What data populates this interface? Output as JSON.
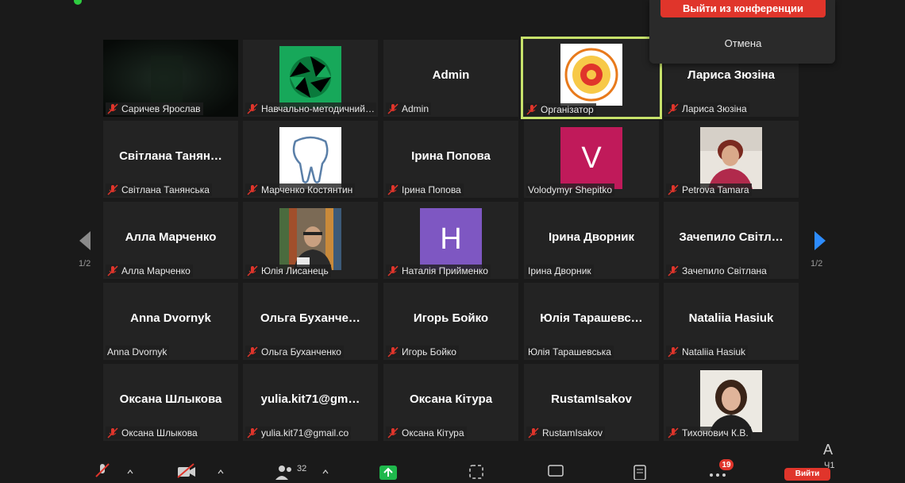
{
  "popup": {
    "leave_label": "Выйти из конференции",
    "cancel_label": "Отмена"
  },
  "pagination": {
    "left": "1/2",
    "right": "1/2"
  },
  "tiles": [
    {
      "name": "Саричев Ярослав",
      "center": "",
      "muted": true
    },
    {
      "name": "Навчально-методичний…",
      "center": "",
      "muted": true
    },
    {
      "name": "Admin",
      "center": "Admin",
      "muted": true
    },
    {
      "name": "Організатор",
      "center": "",
      "muted": true
    },
    {
      "name": "Лариса Зюзіна",
      "center": "Лариса Зюзіна",
      "muted": true
    },
    {
      "name": "Світлана Танянська",
      "center": "Світлана Танян…",
      "muted": true
    },
    {
      "name": "Марченко Костянтин",
      "center": "",
      "muted": true
    },
    {
      "name": "Ірина Попова",
      "center": "Ірина Попова",
      "muted": true
    },
    {
      "name": "Volodymyr Shepitko",
      "center": "",
      "muted": false,
      "letter": "V"
    },
    {
      "name": "Petrova Tamara",
      "center": "",
      "muted": true
    },
    {
      "name": "Алла Марченко",
      "center": "Алла Марченко",
      "muted": true
    },
    {
      "name": "Юлія Лисанець",
      "center": "",
      "muted": true
    },
    {
      "name": "Наталія Приймeнко",
      "center": "",
      "muted": true,
      "letter": "H"
    },
    {
      "name": "Ірина Дворник",
      "center": "Ірина Дворник",
      "muted": false
    },
    {
      "name": "Зачепило Світлана",
      "center": "Зачепило  Світл…",
      "muted": true
    },
    {
      "name": "Anna Dvornyk",
      "center": "Anna Dvornyk",
      "muted": false
    },
    {
      "name": "Ольга Буханченко",
      "center": "Ольга  Буханче…",
      "muted": true
    },
    {
      "name": "Игорь Бойко",
      "center": "Игорь Бойко",
      "muted": true
    },
    {
      "name": "Юлія Тарашевська",
      "center": "Юлія  Тарашевс…",
      "muted": false
    },
    {
      "name": "Nataliia Hasiuk",
      "center": "Nataliia Hasiuk",
      "muted": true
    },
    {
      "name": "Оксана Шлыкова",
      "center": "Оксана Шлыкова",
      "muted": true
    },
    {
      "name": "yulia.kit71@gmail.co",
      "center": "yulia.kit71@gm…",
      "muted": true
    },
    {
      "name": "Оксана Кітура",
      "center": "Оксана Кітура",
      "muted": true
    },
    {
      "name": "RustamIsakov",
      "center": "RustamIsakov",
      "muted": true
    },
    {
      "name": "Тихонович К.В.",
      "center": "",
      "muted": true
    }
  ],
  "toolbar": {
    "participants_count": "32",
    "chat_badge": "19",
    "end_label": "Вийти",
    "side_a": "A",
    "side_b": "Ч1"
  },
  "colors": {
    "speaking_border": "#c7e26b",
    "end_red": "#e0352b",
    "letter_v_bg": "#c01a5a",
    "letter_h_bg": "#7e57c2"
  }
}
